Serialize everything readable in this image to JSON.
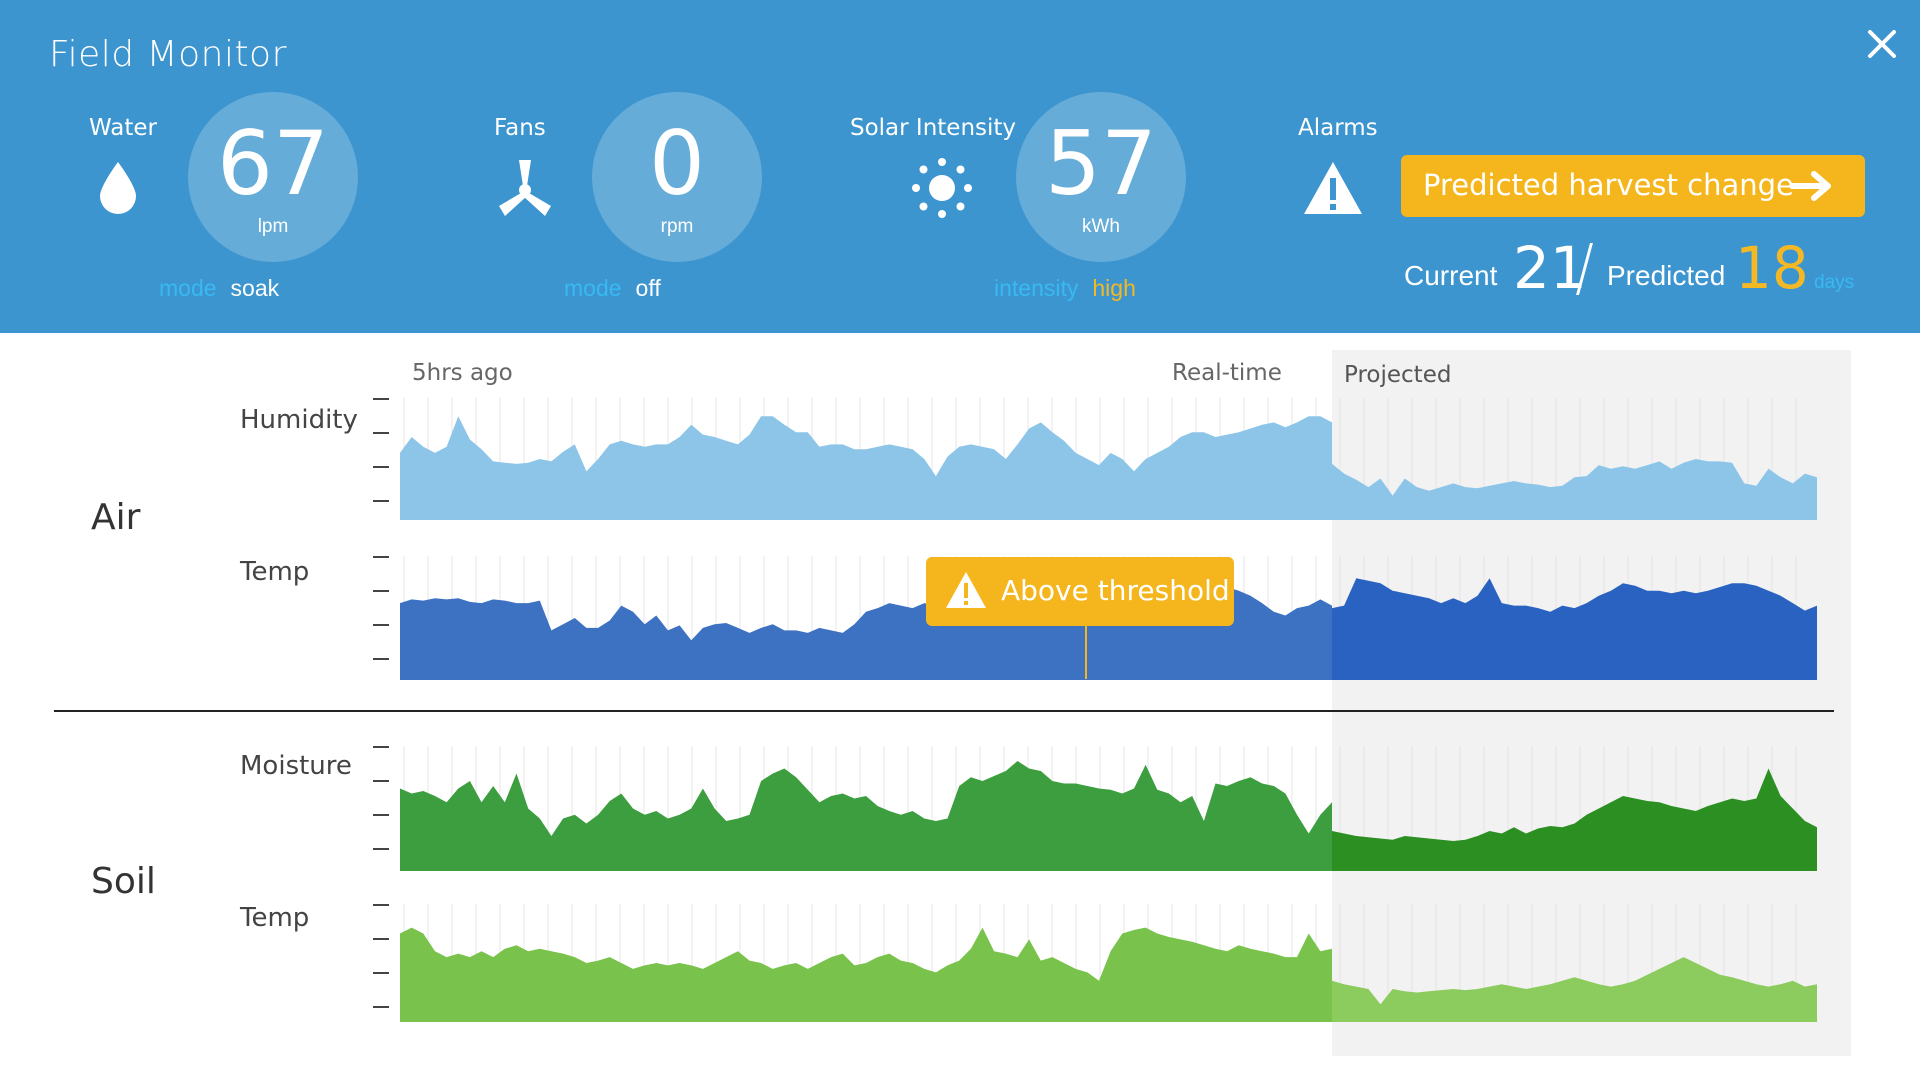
{
  "header": {
    "title": "Field Monitor",
    "background": "#3c95cf",
    "accent": "#f5b51c",
    "mode_key_color": "#39b9f2"
  },
  "gauges": {
    "water": {
      "label": "Water",
      "icon": "water-drop-icon",
      "value": "67",
      "unit": "lpm",
      "mode_key": "mode",
      "mode_value": "soak"
    },
    "fans": {
      "label": "Fans",
      "icon": "fan-icon",
      "value": "0",
      "unit": "rpm",
      "mode_key": "mode",
      "mode_value": "off"
    },
    "solar": {
      "label": "Solar Intensity",
      "icon": "sun-icon",
      "value": "57",
      "unit": "kWh",
      "mode_key": "intensity",
      "mode_value": "high"
    }
  },
  "alarms": {
    "label": "Alarms",
    "icon": "warning-icon",
    "button_label": "Predicted harvest change",
    "current_label": "Current",
    "current_value": "21",
    "predicted_label": "Predicted",
    "predicted_value": "18",
    "predicted_unit": "days"
  },
  "timeline": {
    "start": "5hrs ago",
    "now": "Real-time",
    "projected": "Projected"
  },
  "sections": {
    "air": "Air",
    "soil": "Soil"
  },
  "rows": {
    "humidity": "Humidity",
    "air_temp": "Temp",
    "moisture": "Moisture",
    "soil_temp": "Temp"
  },
  "tooltip": {
    "label": "Above threshold",
    "icon": "warning-icon"
  },
  "chart_data": [
    {
      "type": "area",
      "series": [
        {
          "name": "Humidity",
          "color": "#8dc5e8",
          "projected_color": "#8dc5e8",
          "values": [
            0.55,
            0.68,
            0.6,
            0.55,
            0.6,
            0.85,
            0.66,
            0.58,
            0.48,
            0.47,
            0.46,
            0.47,
            0.5,
            0.48,
            0.56,
            0.62,
            0.4,
            0.5,
            0.62,
            0.65,
            0.62,
            0.6,
            0.62,
            0.62,
            0.68,
            0.78,
            0.7,
            0.68,
            0.65,
            0.62,
            0.7,
            0.85,
            0.85,
            0.78,
            0.72,
            0.72,
            0.6,
            0.62,
            0.62,
            0.58,
            0.58,
            0.6,
            0.62,
            0.6,
            0.58,
            0.5,
            0.36,
            0.52,
            0.6,
            0.62,
            0.6,
            0.58,
            0.5,
            0.62,
            0.75,
            0.8,
            0.72,
            0.65,
            0.55,
            0.5,
            0.45,
            0.55,
            0.5,
            0.4,
            0.5,
            0.55,
            0.6,
            0.68,
            0.72,
            0.72,
            0.68,
            0.7,
            0.72,
            0.75,
            0.78,
            0.8,
            0.76,
            0.8,
            0.85,
            0.85,
            0.8
          ],
          "projected_values": [
            0.46,
            0.38,
            0.33,
            0.27,
            0.34,
            0.2,
            0.34,
            0.27,
            0.24,
            0.27,
            0.3,
            0.27,
            0.26,
            0.28,
            0.3,
            0.32,
            0.3,
            0.29,
            0.27,
            0.28,
            0.35,
            0.36,
            0.45,
            0.42,
            0.44,
            0.42,
            0.45,
            0.48,
            0.42,
            0.47,
            0.5,
            0.48,
            0.48,
            0.47,
            0.3,
            0.28,
            0.42,
            0.35,
            0.3,
            0.38,
            0.35
          ]
        }
      ]
    },
    {
      "type": "area",
      "series": [
        {
          "name": "Temp",
          "color": "#3d72c3",
          "projected_color": "#2a62c1",
          "values": [
            0.62,
            0.65,
            0.64,
            0.66,
            0.65,
            0.66,
            0.63,
            0.62,
            0.65,
            0.64,
            0.62,
            0.62,
            0.64,
            0.4,
            0.45,
            0.5,
            0.42,
            0.42,
            0.48,
            0.6,
            0.55,
            0.45,
            0.52,
            0.4,
            0.44,
            0.32,
            0.42,
            0.45,
            0.46,
            0.42,
            0.38,
            0.42,
            0.45,
            0.4,
            0.4,
            0.38,
            0.42,
            0.4,
            0.38,
            0.45,
            0.55,
            0.58,
            0.62,
            0.6,
            0.58,
            0.62,
            0.6,
            0.58,
            0.62,
            0.65,
            0.62,
            0.65,
            0.62,
            0.6,
            0.62,
            0.66,
            0.65,
            0.62,
            0.58,
            0.55,
            0.6,
            0.62,
            0.6,
            0.6,
            0.58,
            0.6,
            0.65,
            0.66,
            0.62,
            0.6,
            0.7,
            0.75,
            0.72,
            0.68,
            0.62,
            0.55,
            0.52,
            0.58,
            0.6,
            0.65,
            0.6
          ],
          "projected_values": [
            0.58,
            0.6,
            0.82,
            0.8,
            0.78,
            0.72,
            0.7,
            0.68,
            0.66,
            0.62,
            0.66,
            0.62,
            0.68,
            0.82,
            0.62,
            0.6,
            0.6,
            0.58,
            0.55,
            0.6,
            0.58,
            0.62,
            0.68,
            0.72,
            0.78,
            0.76,
            0.72,
            0.72,
            0.7,
            0.72,
            0.7,
            0.72,
            0.75,
            0.78,
            0.78,
            0.76,
            0.72,
            0.68,
            0.62,
            0.56,
            0.6
          ]
        }
      ]
    },
    {
      "type": "area",
      "series": [
        {
          "name": "Moisture",
          "color": "#3d9e3f",
          "projected_color": "#2b8f22",
          "values": [
            0.66,
            0.62,
            0.64,
            0.6,
            0.55,
            0.66,
            0.72,
            0.55,
            0.68,
            0.55,
            0.78,
            0.5,
            0.42,
            0.28,
            0.42,
            0.45,
            0.38,
            0.45,
            0.56,
            0.62,
            0.5,
            0.45,
            0.48,
            0.42,
            0.45,
            0.5,
            0.66,
            0.5,
            0.4,
            0.42,
            0.45,
            0.72,
            0.78,
            0.82,
            0.75,
            0.65,
            0.55,
            0.6,
            0.62,
            0.58,
            0.6,
            0.52,
            0.48,
            0.45,
            0.48,
            0.42,
            0.4,
            0.42,
            0.68,
            0.75,
            0.72,
            0.76,
            0.8,
            0.88,
            0.82,
            0.8,
            0.72,
            0.7,
            0.7,
            0.68,
            0.66,
            0.65,
            0.62,
            0.66,
            0.85,
            0.65,
            0.62,
            0.55,
            0.6,
            0.4,
            0.7,
            0.68,
            0.72,
            0.75,
            0.7,
            0.68,
            0.62,
            0.45,
            0.3,
            0.45,
            0.55
          ],
          "projected_values": [
            0.32,
            0.3,
            0.28,
            0.27,
            0.26,
            0.25,
            0.28,
            0.27,
            0.26,
            0.25,
            0.24,
            0.25,
            0.28,
            0.32,
            0.3,
            0.35,
            0.3,
            0.34,
            0.36,
            0.35,
            0.38,
            0.45,
            0.5,
            0.55,
            0.6,
            0.58,
            0.56,
            0.55,
            0.52,
            0.5,
            0.48,
            0.52,
            0.55,
            0.58,
            0.56,
            0.58,
            0.82,
            0.6,
            0.5,
            0.4,
            0.35
          ]
        }
      ]
    },
    {
      "type": "area",
      "series": [
        {
          "name": "Temp",
          "color": "#79c24c",
          "projected_color": "#8ccb5e",
          "values": [
            0.75,
            0.8,
            0.75,
            0.6,
            0.55,
            0.58,
            0.55,
            0.6,
            0.55,
            0.62,
            0.65,
            0.6,
            0.62,
            0.6,
            0.58,
            0.55,
            0.5,
            0.52,
            0.55,
            0.5,
            0.45,
            0.48,
            0.5,
            0.48,
            0.5,
            0.48,
            0.45,
            0.5,
            0.55,
            0.6,
            0.52,
            0.5,
            0.45,
            0.48,
            0.5,
            0.45,
            0.5,
            0.55,
            0.58,
            0.48,
            0.5,
            0.55,
            0.58,
            0.52,
            0.5,
            0.45,
            0.42,
            0.48,
            0.52,
            0.62,
            0.8,
            0.6,
            0.58,
            0.55,
            0.7,
            0.52,
            0.55,
            0.5,
            0.45,
            0.42,
            0.35,
            0.6,
            0.75,
            0.78,
            0.8,
            0.75,
            0.72,
            0.7,
            0.68,
            0.65,
            0.62,
            0.6,
            0.65,
            0.62,
            0.6,
            0.58,
            0.55,
            0.55,
            0.75,
            0.6,
            0.62
          ],
          "projected_values": [
            0.35,
            0.32,
            0.3,
            0.28,
            0.15,
            0.28,
            0.26,
            0.25,
            0.26,
            0.27,
            0.28,
            0.27,
            0.28,
            0.3,
            0.32,
            0.3,
            0.28,
            0.3,
            0.32,
            0.35,
            0.38,
            0.35,
            0.32,
            0.3,
            0.32,
            0.35,
            0.4,
            0.45,
            0.5,
            0.55,
            0.5,
            0.45,
            0.4,
            0.38,
            0.35,
            0.32,
            0.3,
            0.32,
            0.35,
            0.3,
            0.32
          ]
        }
      ]
    }
  ]
}
